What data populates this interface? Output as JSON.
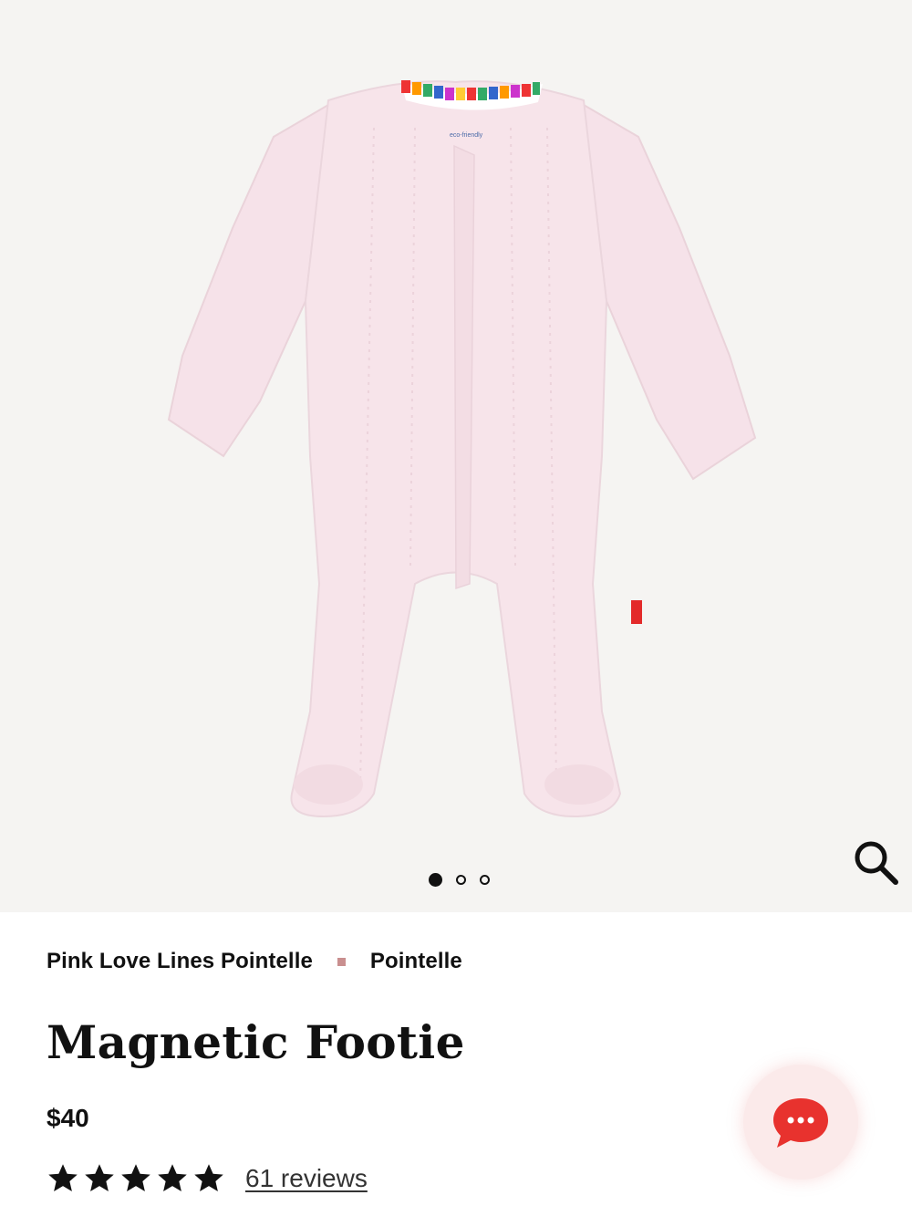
{
  "gallery": {
    "image_alt": "Pink pointelle magnetic footie",
    "garment_tag": "eco-friendly",
    "slide_count": 3,
    "active_slide": 1,
    "zoom_icon": "search-icon"
  },
  "product": {
    "collection": "Pink Love Lines Pointelle",
    "category": "Pointelle",
    "title": "Magnetic Footie",
    "price": "$40",
    "rating_stars": 5,
    "reviews_label": "61 reviews"
  },
  "chat": {
    "icon": "chat-bubble-icon"
  },
  "colors": {
    "gallery_bg": "#f5f4f2",
    "garment": "#f7e4ea",
    "separator": "#c98f8f",
    "chat_accent": "#e8322e"
  }
}
